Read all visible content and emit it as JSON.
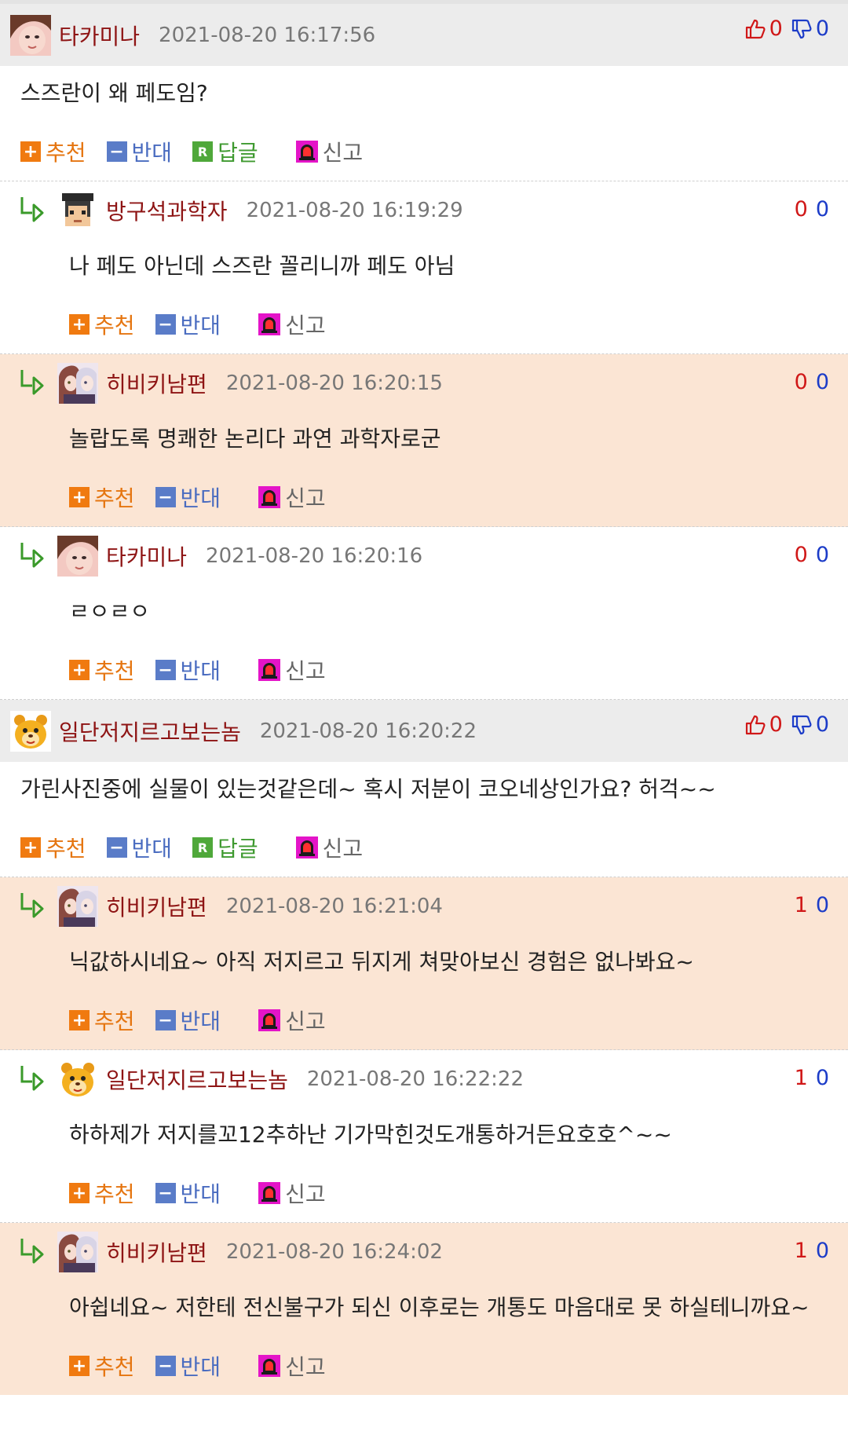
{
  "labels": {
    "recommend": "추천",
    "oppose": "반대",
    "reply": "답글",
    "report": "신고"
  },
  "comments": [
    {
      "nick": "타카미나",
      "date": "2021-08-20 16:17:56",
      "up": "0",
      "down": "0",
      "text": "스즈란이 왜 페도임?"
    },
    {
      "nick": "방구석과학자",
      "date": "2021-08-20 16:19:29",
      "up": "0",
      "down": "0",
      "text": "나 페도 아닌데 스즈란 꼴리니까 페도 아님"
    },
    {
      "nick": "히비키남편",
      "date": "2021-08-20 16:20:15",
      "up": "0",
      "down": "0",
      "text": "놀랍도록 명쾌한 논리다 과연 과학자로군"
    },
    {
      "nick": "타카미나",
      "date": "2021-08-20 16:20:16",
      "up": "0",
      "down": "0",
      "text": "ㄹㅇㄹㅇ"
    },
    {
      "nick": "일단저지르고보는놈",
      "date": "2021-08-20 16:20:22",
      "up": "0",
      "down": "0",
      "text": "가린사진중에 실물이 있는것같은데~ 혹시 저분이 코오네상인가요? 허걱~~"
    },
    {
      "nick": "히비키남편",
      "date": "2021-08-20 16:21:04",
      "up": "1",
      "down": "0",
      "text": "닉값하시네요~ 아직 저지르고 뒤지게 쳐맞아보신 경험은 없나봐요~"
    },
    {
      "nick": "일단저지르고보는놈",
      "date": "2021-08-20 16:22:22",
      "up": "1",
      "down": "0",
      "text": "하하제가 저지를꼬12추하난 기가막힌것도개통하거든요호호^~~"
    },
    {
      "nick": "히비키남편",
      "date": "2021-08-20 16:24:02",
      "up": "1",
      "down": "0",
      "text": "아쉽네요~ 저한테 전신불구가 되신 이후로는 개통도 마음대로 못 하실테니까요~"
    }
  ]
}
